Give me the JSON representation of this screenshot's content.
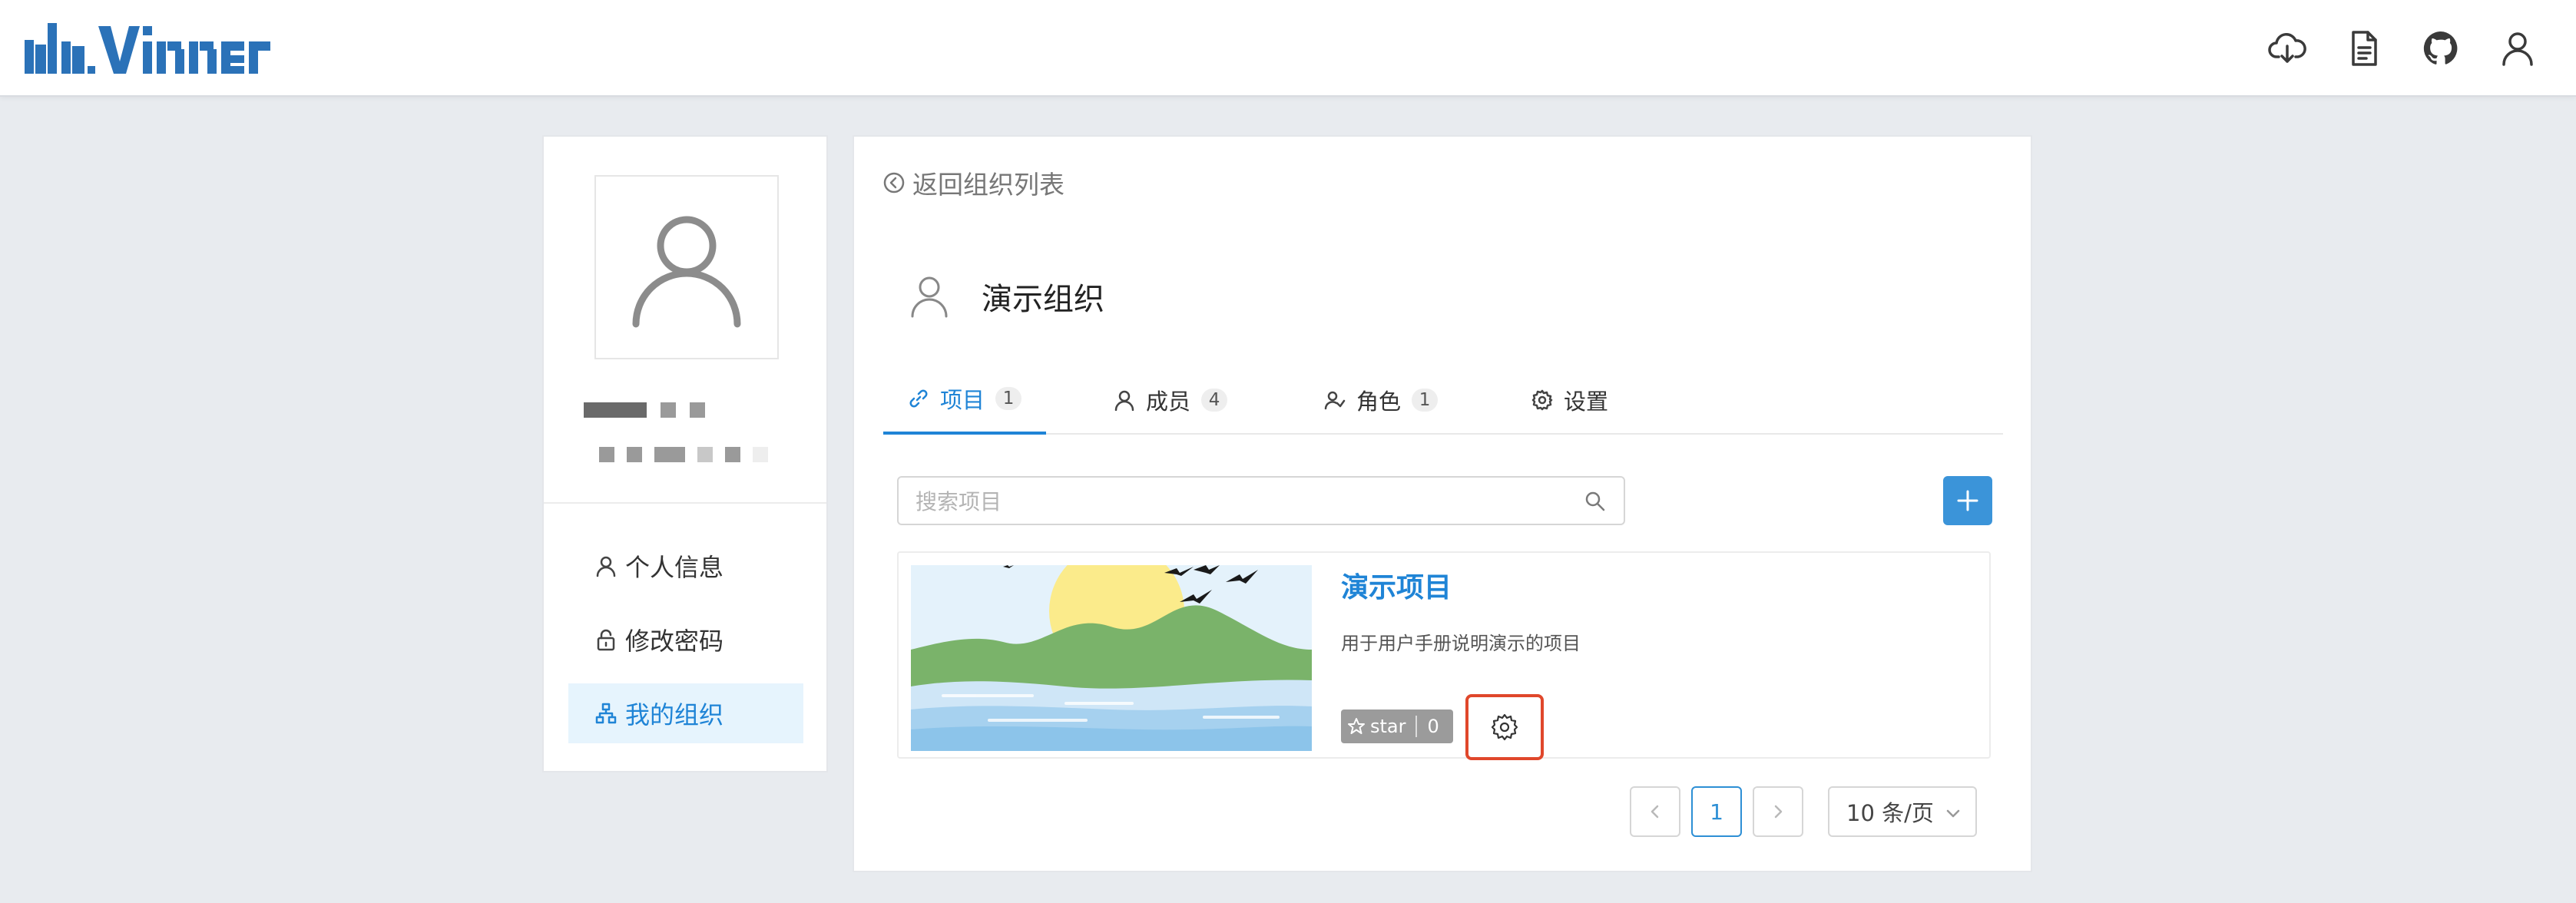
{
  "header": {
    "logo_text": "davinci",
    "icons": [
      "cloud-download-icon",
      "document-icon",
      "github-icon",
      "user-icon"
    ]
  },
  "sidebar": {
    "items": [
      {
        "label": "个人信息",
        "icon": "user-icon"
      },
      {
        "label": "修改密码",
        "icon": "lock-icon"
      },
      {
        "label": "我的组织",
        "icon": "org-icon",
        "active": true
      }
    ]
  },
  "main": {
    "back_label": "返回组织列表",
    "org_name": "演示组织",
    "tabs": [
      {
        "label": "项目",
        "count": "1",
        "icon": "link-icon",
        "active": true
      },
      {
        "label": "成员",
        "count": "4",
        "icon": "user-icon"
      },
      {
        "label": "角色",
        "count": "1",
        "icon": "roles-icon"
      },
      {
        "label": "设置",
        "icon": "gear-icon"
      }
    ],
    "search": {
      "placeholder": "搜索项目"
    },
    "project": {
      "title": "演示项目",
      "description": "用于用户手册说明演示的项目",
      "star_label": "star",
      "star_count": "0"
    },
    "pagination": {
      "current_page": "1",
      "page_size": "10 条/页"
    }
  },
  "colors": {
    "accent": "#1f84d6",
    "add_button": "#3b94d9",
    "highlight_border": "#e0472b",
    "background": "#e8ebef"
  }
}
